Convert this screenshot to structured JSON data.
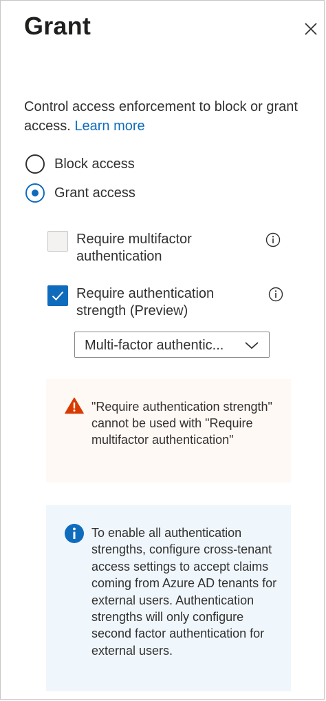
{
  "header": {
    "title": "Grant",
    "close_icon": "close-icon"
  },
  "description": {
    "text": "Control access enforcement to block or grant access. ",
    "link_text": "Learn more"
  },
  "radio_options": [
    {
      "label": "Block access",
      "checked": false
    },
    {
      "label": "Grant access",
      "checked": true
    }
  ],
  "controls": [
    {
      "label": "Require multifactor authentication",
      "checked": false,
      "icon": "info-icon"
    },
    {
      "label": "Require authentication strength (Preview)",
      "checked": true,
      "icon": "info-icon"
    }
  ],
  "dropdown": {
    "selected": "Multi-factor authentic...",
    "icon": "chevron-down-icon"
  },
  "warning": {
    "icon": "warning-icon",
    "text": "\"Require authentication strength\" cannot be used with \"Require multifactor authentication\""
  },
  "info": {
    "icon": "info-circle-icon",
    "text": "To enable all authentication strengths, configure cross-tenant access settings to accept claims coming from Azure AD tenants for external users. Authentication strengths will only configure second factor authentication for external users."
  },
  "colors": {
    "accent": "#0f6cbd",
    "warning_icon": "#d83b01",
    "warning_bg": "#fff9f5",
    "info_bg": "#eff6fc"
  }
}
